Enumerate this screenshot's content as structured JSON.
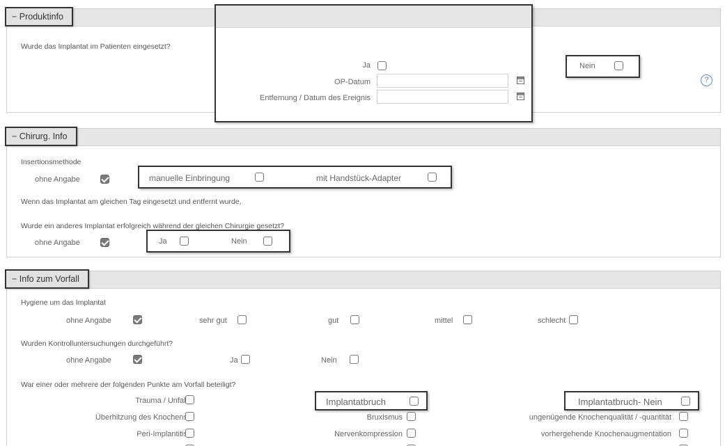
{
  "produktinfo": {
    "title": "− Produktinfo",
    "question": "Wurde das Implantat im Patienten eingesetzt?",
    "ja_label": "Ja",
    "ja_checked": false,
    "op_datum_label": "OP-Datum",
    "op_datum_value": "",
    "entfernung_label": "Entfernung / Datum des Ereignis",
    "entfernung_value": "",
    "nein_label": "Nein",
    "nein_checked": false,
    "help_glyph": "?"
  },
  "chirurg": {
    "title": "− Chirurg. Info",
    "insertion_label": "Insertionsmethode",
    "ohne_angabe_label": "ohne Angabe",
    "ohne_angabe_checked": true,
    "manuelle_label": "manuelle Einbringung",
    "manuelle_checked": false,
    "handstueck_label": "mit Handstück-Adapter",
    "handstueck_checked": false,
    "same_day_text": "Wenn das Implantat am gleichen Tag eingesetzt und entfernt wurde,",
    "other_implant_question": "Wurde ein anderes Implantat erfolgreich während der gleichen Chirurgie gesetzt?",
    "ohne_angabe2_label": "ohne Angabe",
    "ohne_angabe2_checked": true,
    "ja_label": "Ja",
    "ja_checked": false,
    "nein_label": "Nein",
    "nein_checked": false
  },
  "vorfall": {
    "title": "− Info zum Vorfall",
    "hygiene_label": "Hygiene um das Implantat",
    "hygiene_options": [
      "ohne Angabe",
      "sehr gut",
      "gut",
      "mittel",
      "schlecht"
    ],
    "hygiene_checked": [
      true,
      false,
      false,
      false,
      false
    ],
    "kontroll_label": "Wurden Kontrolluntersuchungen durchgeführt?",
    "kontroll_options": [
      "ohne Angabe",
      "Ja",
      "Nein"
    ],
    "kontroll_checked": [
      true,
      false,
      false
    ],
    "punkte_label": "War einer oder mehrere der folgenden Punkte am Vorfall beteiligt?",
    "trauma_label": "Trauma / Unfall",
    "ueberhitzung_label": "Überhitzung des Knochens",
    "periimplantitis_label": "Peri-Implantitis",
    "implantatbruch_label": "Implantatbruch",
    "bruxismus_label": "Bruxismus",
    "nervenkompression_label": "Nervenkompression",
    "implantatbruch_nein_label": "Implantatbruch- Nein",
    "knochenqualitaet_label": "ungenügende Knochenqualität / -quantität",
    "knochenaugmentation_label": "vorhergehende Knochenaugmentation"
  }
}
